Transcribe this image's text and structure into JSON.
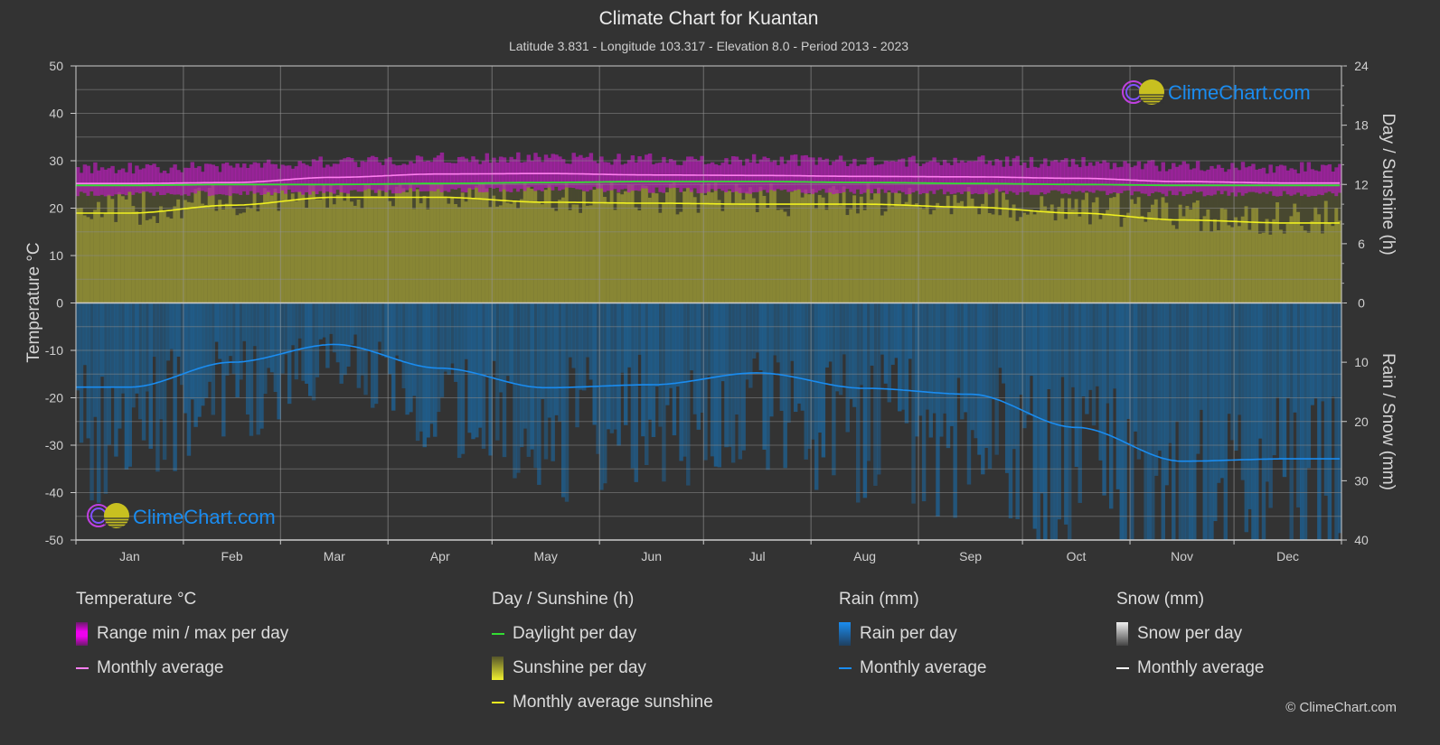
{
  "title": "Climate Chart for Kuantan",
  "subtitle": "Latitude 3.831 - Longitude 103.317 - Elevation 8.0 - Period 2013 - 2023",
  "logo_text": "ClimeChart.com",
  "copyright": "© ClimeChart.com",
  "colors": {
    "background": "#333333",
    "temp_range": "#b020b0",
    "temp_avg": "#ff7ff0",
    "daylight": "#33dd33",
    "sunshine_fill": "#8c8a35",
    "sunshine_avg": "#f0f020",
    "rain_fill": "#1f5f8f",
    "rain_avg": "#1a8cf0",
    "snow_avg": "#ffffff"
  },
  "legend": {
    "temperature": {
      "title": "Temperature °C",
      "items": [
        "Range min / max per day",
        "Monthly average"
      ]
    },
    "sunshine": {
      "title": "Day / Sunshine (h)",
      "items": [
        "Daylight per day",
        "Sunshine per day",
        "Monthly average sunshine"
      ]
    },
    "rain": {
      "title": "Rain (mm)",
      "items": [
        "Rain per day",
        "Monthly average"
      ]
    },
    "snow": {
      "title": "Snow (mm)",
      "items": [
        "Snow per day",
        "Monthly average"
      ]
    }
  },
  "chart_data": {
    "type": "line",
    "title": "Climate Chart for Kuantan",
    "categories": [
      "Jan",
      "Feb",
      "Mar",
      "Apr",
      "May",
      "Jun",
      "Jul",
      "Aug",
      "Sep",
      "Oct",
      "Nov",
      "Dec"
    ],
    "left_axis": {
      "label": "Temperature °C",
      "range": [
        -50,
        50
      ],
      "ticks": [
        50,
        40,
        30,
        20,
        10,
        0,
        -10,
        -20,
        -30,
        -40,
        -50
      ]
    },
    "right_axis_top": {
      "label": "Day / Sunshine (h)",
      "range": [
        0,
        24
      ],
      "ticks": [
        24,
        18,
        12,
        6,
        0
      ]
    },
    "right_axis_bottom": {
      "label": "Rain / Snow (mm)",
      "range": [
        0,
        40
      ],
      "ticks": [
        0,
        10,
        20,
        30,
        40
      ]
    },
    "grid": true,
    "series": [
      {
        "name": "Temperature monthly average (°C)",
        "axis": "left",
        "values": [
          25.2,
          25.4,
          26.5,
          27.2,
          27.3,
          27.0,
          26.9,
          26.7,
          26.6,
          26.3,
          25.6,
          25.3
        ]
      },
      {
        "name": "Temperature daily max approx (°C)",
        "axis": "left",
        "values": [
          28.5,
          28.8,
          29.8,
          30.5,
          30.6,
          30.3,
          30.2,
          30.0,
          29.9,
          29.6,
          28.8,
          28.5
        ]
      },
      {
        "name": "Temperature daily min approx (°C)",
        "axis": "left",
        "values": [
          23.0,
          23.1,
          23.5,
          23.8,
          24.0,
          23.8,
          23.6,
          23.5,
          23.4,
          23.3,
          23.1,
          23.0
        ]
      },
      {
        "name": "Daylight per day (h)",
        "axis": "right_top",
        "values": [
          11.9,
          12.0,
          12.0,
          12.1,
          12.2,
          12.3,
          12.3,
          12.2,
          12.1,
          12.0,
          11.9,
          11.9
        ]
      },
      {
        "name": "Monthly average sunshine (h)",
        "axis": "right_top",
        "values": [
          9.1,
          9.9,
          10.7,
          10.7,
          10.2,
          10.1,
          10.0,
          10.0,
          9.7,
          9.1,
          8.4,
          8.1
        ]
      },
      {
        "name": "Rain monthly average (mm)",
        "axis": "right_bottom",
        "values": [
          14.2,
          10.0,
          7.0,
          11.0,
          14.3,
          13.8,
          11.8,
          14.4,
          15.4,
          21.0,
          26.7,
          26.3
        ]
      },
      {
        "name": "Snow monthly average (mm)",
        "axis": "right_bottom",
        "values": [
          0,
          0,
          0,
          0,
          0,
          0,
          0,
          0,
          0,
          0,
          0,
          0
        ]
      }
    ]
  }
}
